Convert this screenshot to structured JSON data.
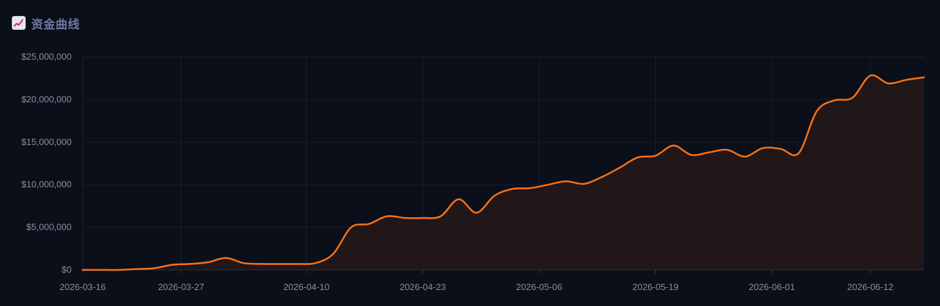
{
  "header": {
    "icon": "chart-increasing-icon",
    "title": "资金曲线"
  },
  "colors": {
    "background": "#0b0f1a",
    "line": "#f97316",
    "area": "#211618",
    "grid": "#1a1f2b",
    "tick_text": "#8a8f9c",
    "title": "#6e7aa3"
  },
  "chart_data": {
    "type": "area",
    "title": "资金曲线",
    "xlabel": "",
    "ylabel": "",
    "grid": true,
    "legend": "none",
    "x_ticks": [
      "2026-03-16",
      "2026-03-27",
      "2026-04-10",
      "2026-04-23",
      "2026-05-06",
      "2026-05-19",
      "2026-06-01",
      "2026-06-12"
    ],
    "y_ticks": [
      "$0",
      "$5,000,000",
      "$10,000,000",
      "$15,000,000",
      "$20,000,000",
      "$25,000,000"
    ],
    "ylim": [
      0,
      25000000
    ],
    "xlim": [
      "2026-03-16",
      "2026-06-18"
    ],
    "series": [
      {
        "x": [
          "2026-03-16",
          "2026-03-18",
          "2026-03-20",
          "2026-03-22",
          "2026-03-24",
          "2026-03-26",
          "2026-03-28",
          "2026-03-30",
          "2026-04-01",
          "2026-04-03",
          "2026-04-05",
          "2026-04-07",
          "2026-04-09",
          "2026-04-11",
          "2026-04-13",
          "2026-04-15",
          "2026-04-17",
          "2026-04-19",
          "2026-04-21",
          "2026-04-23",
          "2026-04-25",
          "2026-04-27",
          "2026-04-29",
          "2026-05-01",
          "2026-05-03",
          "2026-05-05",
          "2026-05-07",
          "2026-05-09",
          "2026-05-11",
          "2026-05-13",
          "2026-05-15",
          "2026-05-17",
          "2026-05-19",
          "2026-05-21",
          "2026-05-23",
          "2026-05-25",
          "2026-05-27",
          "2026-05-29",
          "2026-05-31",
          "2026-06-02",
          "2026-06-04",
          "2026-06-06",
          "2026-06-08",
          "2026-06-10",
          "2026-06-12",
          "2026-06-14",
          "2026-06-16",
          "2026-06-18"
        ],
        "values": [
          0,
          0,
          0,
          100000,
          200000,
          600000,
          700000,
          900000,
          1400000,
          800000,
          700000,
          700000,
          700000,
          800000,
          1900000,
          5000000,
          5400000,
          6300000,
          6100000,
          6100000,
          6300000,
          8300000,
          6700000,
          8700000,
          9500000,
          9600000,
          10000000,
          10400000,
          10100000,
          10900000,
          12000000,
          13200000,
          13400000,
          14600000,
          13500000,
          13800000,
          14100000,
          13300000,
          14300000,
          14200000,
          13700000,
          18600000,
          19900000,
          20200000,
          22800000,
          21900000,
          22300000,
          22600000
        ]
      }
    ]
  }
}
